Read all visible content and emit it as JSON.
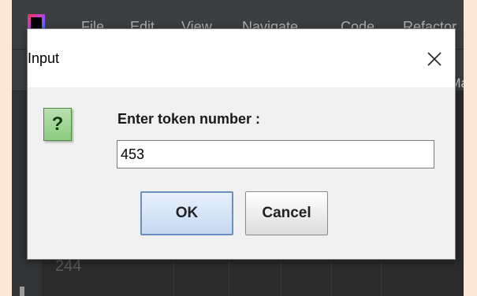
{
  "ide": {
    "menu": [
      "File",
      "Edit",
      "View",
      "Navigate",
      "Code",
      "Refactor"
    ],
    "toolbar_text": "Ma",
    "line_number": "244"
  },
  "dialog": {
    "title": "Input",
    "prompt": "Enter token number :",
    "input_value": "453",
    "ok_label": "OK",
    "cancel_label": "Cancel",
    "close_icon": "close-icon",
    "question_icon": "question-icon",
    "question_mark": "?"
  }
}
